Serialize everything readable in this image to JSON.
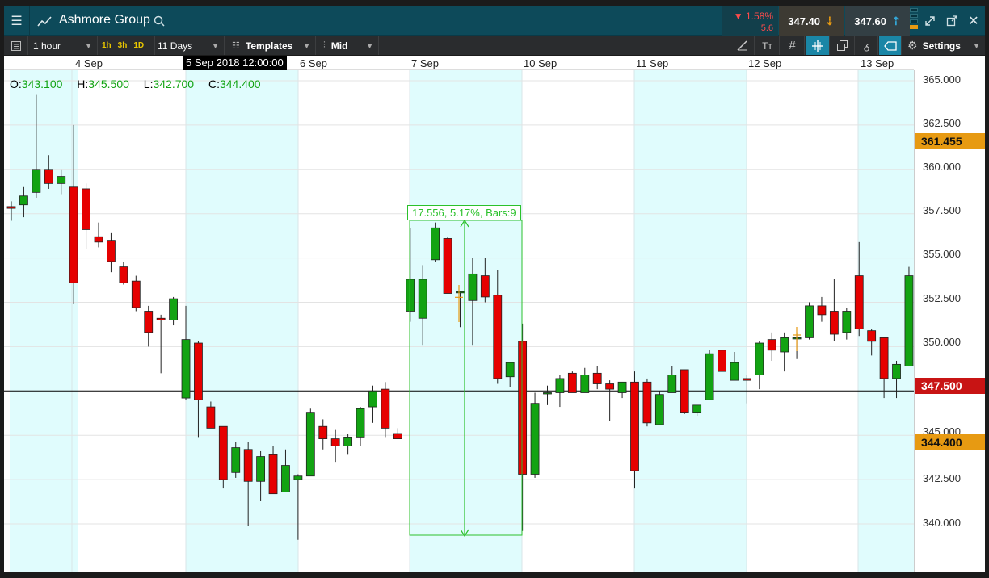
{
  "title_bar": {
    "instrument": "Ashmore Group",
    "change_pct": "▼ 1.58%",
    "change_abs": "5.6",
    "sell_price": "347.40",
    "buy_price": "347.60",
    "icons": [
      "menu-icon",
      "line-chart-icon",
      "search-icon",
      "arrow-down-icon",
      "arrow-up-icon",
      "expand-icon",
      "popout-icon",
      "close-icon"
    ]
  },
  "toolbar": {
    "interval": "1 hour",
    "quick_intervals": [
      "1h",
      "3h",
      "1D"
    ],
    "range": "11 Days",
    "templates_label": "Templates",
    "price_type": "Mid",
    "settings_label": "Settings",
    "icons": [
      "pencil-icon",
      "text-icon",
      "grid-icon",
      "crosshair-icon",
      "layers-icon",
      "indicator-icon",
      "label-icon",
      "gear-icon"
    ]
  },
  "chart": {
    "ohlc": {
      "o_label": "O:",
      "o": "343.100",
      "h_label": "H:",
      "h": "345.500",
      "l_label": "L:",
      "l": "342.700",
      "c_label": "C:",
      "c": "344.400"
    },
    "crosshair_date": "5 Sep 2018 12:00:00",
    "crosshair_price": "347.500",
    "price_tag_high": "361.455",
    "price_tag_close": "344.400",
    "measure_label": "17.556, 5.17%, Bars:9",
    "colors": {
      "up": "#12a312",
      "down": "#e60000",
      "shade": "#e0fcfd",
      "orange": "#e79a12",
      "red_tag": "#c81414",
      "measure": "#2bc12b"
    }
  },
  "chart_data": {
    "type": "candlestick",
    "x_labels": [
      "4 Sep",
      "6 Sep",
      "7 Sep",
      "10 Sep",
      "11 Sep",
      "12 Sep",
      "13 Sep"
    ],
    "y_ticks": [
      "365.000",
      "362.500",
      "360.000",
      "357.500",
      "355.000",
      "352.500",
      "350.000",
      "345.000",
      "342.500",
      "340.000"
    ],
    "ylim": [
      337.5,
      365.5
    ],
    "candles": [
      {
        "o": 357.9,
        "h": 358.2,
        "l": 357.1,
        "c": 357.8
      },
      {
        "o": 358.0,
        "h": 359.0,
        "l": 357.3,
        "c": 358.5
      },
      {
        "o": 358.7,
        "h": 364.2,
        "l": 358.4,
        "c": 360.0
      },
      {
        "o": 360.0,
        "h": 360.8,
        "l": 358.9,
        "c": 359.2
      },
      {
        "o": 359.2,
        "h": 360.0,
        "l": 358.6,
        "c": 359.6
      },
      {
        "o": 359.0,
        "h": 362.5,
        "l": 352.4,
        "c": 353.6
      },
      {
        "o": 358.9,
        "h": 359.2,
        "l": 355.5,
        "c": 356.6
      },
      {
        "o": 356.2,
        "h": 357.0,
        "l": 355.6,
        "c": 355.9
      },
      {
        "o": 356.0,
        "h": 356.4,
        "l": 354.2,
        "c": 354.8
      },
      {
        "o": 354.5,
        "h": 354.8,
        "l": 353.5,
        "c": 353.6
      },
      {
        "o": 353.7,
        "h": 354.0,
        "l": 352.0,
        "c": 352.2
      },
      {
        "o": 352.0,
        "h": 352.3,
        "l": 350.0,
        "c": 350.8
      },
      {
        "o": 351.6,
        "h": 351.8,
        "l": 348.5,
        "c": 351.5
      },
      {
        "o": 351.5,
        "h": 352.8,
        "l": 351.2,
        "c": 352.7
      },
      {
        "o": 347.1,
        "h": 352.3,
        "l": 347.0,
        "c": 350.4
      },
      {
        "o": 350.2,
        "h": 350.3,
        "l": 344.9,
        "c": 347.0
      },
      {
        "o": 346.6,
        "h": 346.9,
        "l": 345.4,
        "c": 345.4
      },
      {
        "o": 345.5,
        "h": 345.5,
        "l": 342.0,
        "c": 342.5
      },
      {
        "o": 342.9,
        "h": 344.6,
        "l": 342.6,
        "c": 344.3
      },
      {
        "o": 344.2,
        "h": 344.6,
        "l": 339.9,
        "c": 342.4
      },
      {
        "o": 342.4,
        "h": 344.1,
        "l": 341.3,
        "c": 343.8
      },
      {
        "o": 343.9,
        "h": 344.4,
        "l": 341.7,
        "c": 341.7
      },
      {
        "o": 341.8,
        "h": 344.2,
        "l": 341.8,
        "c": 343.3
      },
      {
        "o": 342.5,
        "h": 342.8,
        "l": 339.1,
        "c": 342.7
      },
      {
        "o": 342.7,
        "h": 346.5,
        "l": 342.7,
        "c": 346.3
      },
      {
        "o": 345.5,
        "h": 345.9,
        "l": 344.2,
        "c": 344.8
      },
      {
        "o": 344.8,
        "h": 345.3,
        "l": 343.5,
        "c": 344.4
      },
      {
        "o": 344.4,
        "h": 345.1,
        "l": 343.9,
        "c": 344.9
      },
      {
        "o": 344.9,
        "h": 346.6,
        "l": 344.4,
        "c": 346.5
      },
      {
        "o": 346.6,
        "h": 347.8,
        "l": 345.7,
        "c": 347.5
      },
      {
        "o": 347.6,
        "h": 348.0,
        "l": 344.9,
        "c": 345.4
      },
      {
        "o": 345.1,
        "h": 345.4,
        "l": 344.8,
        "c": 344.8
      },
      {
        "o": 352.0,
        "h": 356.7,
        "l": 351.4,
        "c": 353.8
      },
      {
        "o": 351.6,
        "h": 354.6,
        "l": 350.1,
        "c": 353.8
      },
      {
        "o": 354.9,
        "h": 357.0,
        "l": 354.8,
        "c": 356.7
      },
      {
        "o": 356.1,
        "h": 356.2,
        "l": 353.0,
        "c": 353.0
      },
      {
        "o": 353.1,
        "h": 353.1,
        "l": 351.1,
        "c": 353.1
      },
      {
        "o": 352.6,
        "h": 355.0,
        "l": 350.1,
        "c": 354.1
      },
      {
        "o": 354.0,
        "h": 355.0,
        "l": 352.5,
        "c": 352.8
      },
      {
        "o": 352.9,
        "h": 354.3,
        "l": 347.9,
        "c": 348.2
      },
      {
        "o": 348.3,
        "h": 349.1,
        "l": 347.7,
        "c": 349.1
      },
      {
        "o": 350.3,
        "h": 351.3,
        "l": 339.6,
        "c": 342.8
      },
      {
        "o": 342.8,
        "h": 347.4,
        "l": 342.6,
        "c": 346.8
      },
      {
        "o": 347.4,
        "h": 347.8,
        "l": 346.7,
        "c": 347.4
      },
      {
        "o": 347.4,
        "h": 348.4,
        "l": 346.6,
        "c": 348.2
      },
      {
        "o": 348.5,
        "h": 348.6,
        "l": 347.4,
        "c": 347.4
      },
      {
        "o": 347.4,
        "h": 348.8,
        "l": 347.4,
        "c": 348.4
      },
      {
        "o": 348.5,
        "h": 348.9,
        "l": 347.6,
        "c": 347.9
      },
      {
        "o": 347.9,
        "h": 348.1,
        "l": 345.8,
        "c": 347.6
      },
      {
        "o": 347.4,
        "h": 347.9,
        "l": 347.1,
        "c": 348.0
      },
      {
        "o": 348.0,
        "h": 348.6,
        "l": 342.0,
        "c": 343.0
      },
      {
        "o": 348.0,
        "h": 348.2,
        "l": 345.5,
        "c": 345.7
      },
      {
        "o": 345.6,
        "h": 347.5,
        "l": 345.6,
        "c": 347.3
      },
      {
        "o": 347.4,
        "h": 348.9,
        "l": 347.4,
        "c": 348.4
      },
      {
        "o": 348.7,
        "h": 348.7,
        "l": 346.2,
        "c": 346.3
      },
      {
        "o": 346.3,
        "h": 346.7,
        "l": 346.1,
        "c": 346.7
      },
      {
        "o": 347.0,
        "h": 349.8,
        "l": 347.0,
        "c": 349.6
      },
      {
        "o": 349.8,
        "h": 350.0,
        "l": 347.5,
        "c": 348.6
      },
      {
        "o": 348.1,
        "h": 349.7,
        "l": 348.1,
        "c": 349.1
      },
      {
        "o": 348.2,
        "h": 348.4,
        "l": 346.8,
        "c": 348.1
      },
      {
        "o": 348.4,
        "h": 350.3,
        "l": 347.6,
        "c": 350.2
      },
      {
        "o": 350.4,
        "h": 350.8,
        "l": 349.2,
        "c": 349.8
      },
      {
        "o": 349.7,
        "h": 350.8,
        "l": 348.6,
        "c": 350.5
      },
      {
        "o": 350.5,
        "h": 350.8,
        "l": 349.3,
        "c": 350.5
      },
      {
        "o": 350.5,
        "h": 352.5,
        "l": 350.4,
        "c": 352.3
      },
      {
        "o": 352.3,
        "h": 352.8,
        "l": 351.4,
        "c": 351.8
      },
      {
        "o": 352.0,
        "h": 353.8,
        "l": 350.3,
        "c": 350.7
      },
      {
        "o": 350.8,
        "h": 352.2,
        "l": 350.4,
        "c": 352.0
      },
      {
        "o": 354.0,
        "h": 355.9,
        "l": 350.6,
        "c": 351.0
      },
      {
        "o": 350.9,
        "h": 351.0,
        "l": 349.5,
        "c": 350.3
      },
      {
        "o": 350.5,
        "h": 350.5,
        "l": 347.1,
        "c": 348.2
      },
      {
        "o": 348.2,
        "h": 349.2,
        "l": 347.1,
        "c": 349.0
      },
      {
        "o": 348.9,
        "h": 354.5,
        "l": 348.9,
        "c": 354.0
      }
    ]
  }
}
